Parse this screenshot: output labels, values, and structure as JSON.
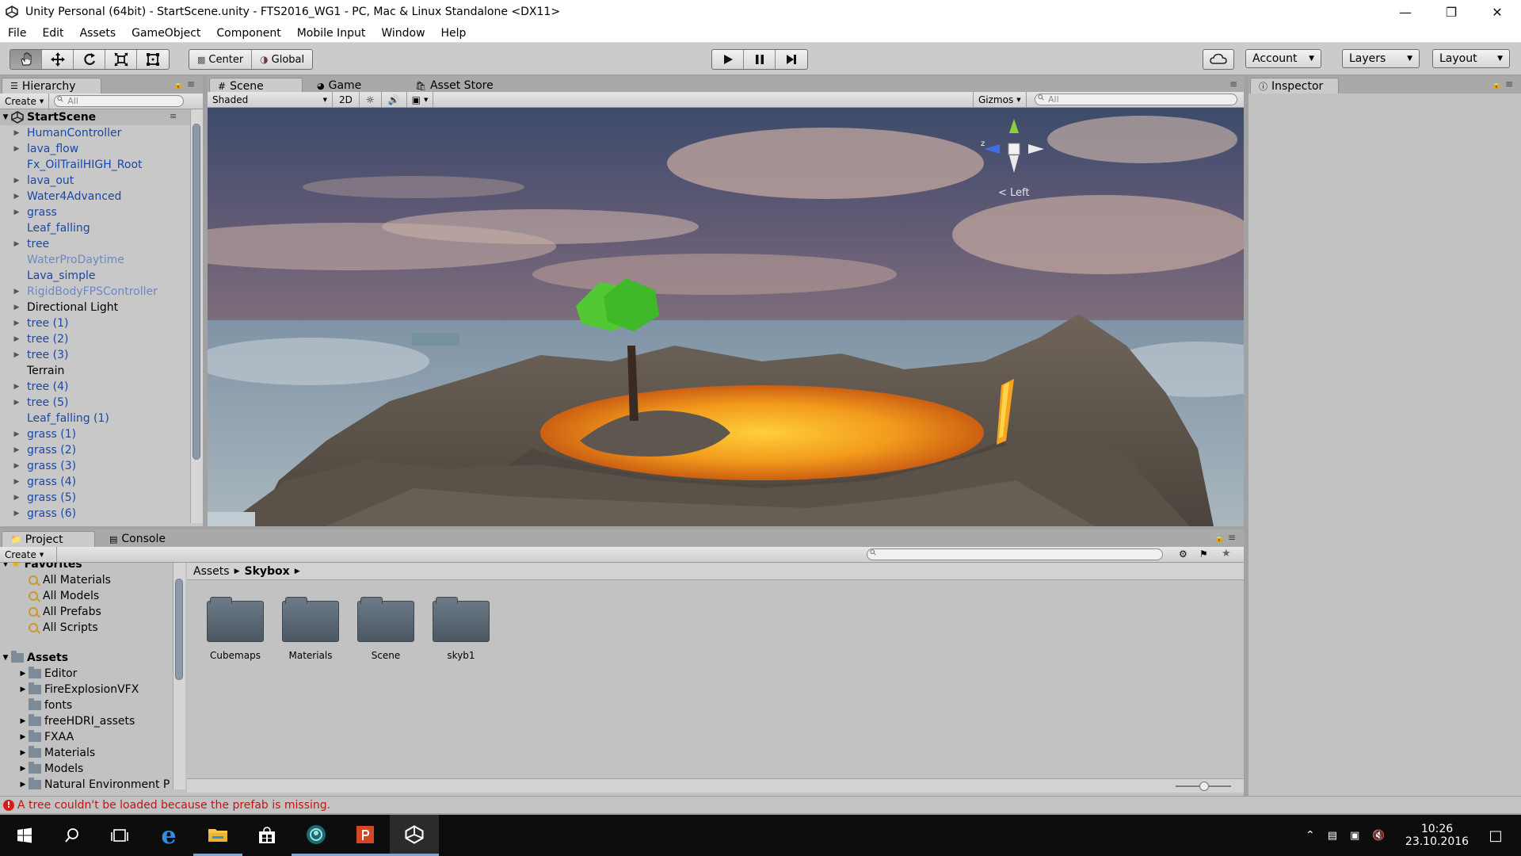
{
  "window": {
    "title": "Unity Personal (64bit) - StartScene.unity - FTS2016_WG1 - PC, Mac & Linux Standalone <DX11>",
    "minimize_glyph": "—",
    "restore_glyph": "❐",
    "close_glyph": "✕"
  },
  "menu": [
    "File",
    "Edit",
    "Assets",
    "GameObject",
    "Component",
    "Mobile Input",
    "Window",
    "Help"
  ],
  "toolbar": {
    "transform_tools": [
      "hand-tool-icon",
      "move-tool-icon",
      "rotate-tool-icon",
      "scale-tool-icon",
      "rect-tool-icon"
    ],
    "pivot_label": "Center",
    "space_label": "Global",
    "account_label": "Account",
    "layers_label": "Layers",
    "layout_label": "Layout"
  },
  "hierarchy": {
    "tab_label": "Hierarchy",
    "create_label": "Create",
    "search_placeholder": "All",
    "scene_name": "StartScene",
    "items": [
      {
        "label": "HumanController",
        "expandable": true,
        "style": "blue"
      },
      {
        "label": "lava_flow",
        "expandable": true,
        "style": "blue"
      },
      {
        "label": "Fx_OilTrailHIGH_Root",
        "expandable": false,
        "style": "blue"
      },
      {
        "label": "lava_out",
        "expandable": true,
        "style": "blue"
      },
      {
        "label": "Water4Advanced",
        "expandable": true,
        "style": "blue"
      },
      {
        "label": "grass",
        "expandable": true,
        "style": "blue"
      },
      {
        "label": "Leaf_falling",
        "expandable": false,
        "style": "blue"
      },
      {
        "label": "tree",
        "expandable": true,
        "style": "blue"
      },
      {
        "label": "WaterProDaytime",
        "expandable": false,
        "style": "lightblue"
      },
      {
        "label": "Lava_simple",
        "expandable": false,
        "style": "blue"
      },
      {
        "label": "RigidBodyFPSController",
        "expandable": true,
        "style": "lightblue"
      },
      {
        "label": "Directional Light",
        "expandable": true,
        "style": "black"
      },
      {
        "label": "tree (1)",
        "expandable": true,
        "style": "blue"
      },
      {
        "label": "tree (2)",
        "expandable": true,
        "style": "blue"
      },
      {
        "label": "tree (3)",
        "expandable": true,
        "style": "blue"
      },
      {
        "label": "Terrain",
        "expandable": false,
        "style": "black"
      },
      {
        "label": "tree (4)",
        "expandable": true,
        "style": "blue"
      },
      {
        "label": "tree (5)",
        "expandable": true,
        "style": "blue"
      },
      {
        "label": "Leaf_falling (1)",
        "expandable": false,
        "style": "blue"
      },
      {
        "label": "grass (1)",
        "expandable": true,
        "style": "blue"
      },
      {
        "label": "grass (2)",
        "expandable": true,
        "style": "blue"
      },
      {
        "label": "grass (3)",
        "expandable": true,
        "style": "blue"
      },
      {
        "label": "grass (4)",
        "expandable": true,
        "style": "blue"
      },
      {
        "label": "grass (5)",
        "expandable": true,
        "style": "blue"
      },
      {
        "label": "grass (6)",
        "expandable": true,
        "style": "blue"
      }
    ]
  },
  "scene": {
    "tabs": [
      "Scene",
      "Game",
      "Asset Store"
    ],
    "shading_mode": "Shaded",
    "mode_2d_label": "2D",
    "gizmos_label": "Gizmos",
    "search_placeholder": "All",
    "gizmo_view_label": "< Left",
    "gizmo_axis_label": "z"
  },
  "inspector": {
    "tab_label": "Inspector"
  },
  "project": {
    "tabs": [
      "Project",
      "Console"
    ],
    "create_label": "Create",
    "favorites_label": "Favorites",
    "favorites": [
      "All Materials",
      "All Models",
      "All Prefabs",
      "All Scripts"
    ],
    "assets_label": "Assets",
    "asset_folders": [
      {
        "label": "Editor",
        "expandable": true
      },
      {
        "label": "FireExplosionVFX",
        "expandable": true
      },
      {
        "label": "fonts",
        "expandable": false
      },
      {
        "label": "freeHDRI_assets",
        "expandable": true
      },
      {
        "label": "FXAA",
        "expandable": true
      },
      {
        "label": "Materials",
        "expandable": true
      },
      {
        "label": "Models",
        "expandable": true
      },
      {
        "label": "Natural Environment P",
        "expandable": true
      }
    ],
    "breadcrumb": [
      "Assets",
      "Skybox"
    ],
    "folders": [
      "Cubemaps",
      "Materials",
      "Scene",
      "skyb1"
    ]
  },
  "status": {
    "message": "A tree couldn't be loaded because the prefab is missing.",
    "error_glyph": "!"
  },
  "taskbar": {
    "apps": [
      "start-icon",
      "search-icon",
      "task-view-icon",
      "edge-icon",
      "file-explorer-icon",
      "store-icon",
      "app-icon",
      "powerpoint-icon",
      "unity-icon"
    ],
    "time": "10:26",
    "date": "23.10.2016"
  },
  "colors": {
    "unity_panel": "#c2c2c2",
    "hierarchy_prefab_blue": "#1b47a5",
    "error_red": "#d41c1c",
    "taskbar": "#0d0d0d"
  }
}
